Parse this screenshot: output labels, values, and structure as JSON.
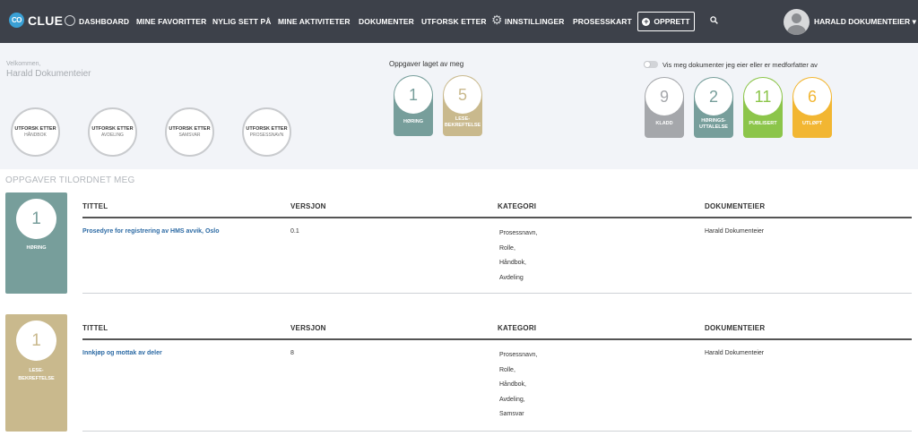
{
  "nav": {
    "logo_mark": "CO",
    "logo_text": "CLUE",
    "items": [
      "DASHBOARD",
      "MINE FAVORITTER",
      "NYLIG SETT PÅ",
      "MINE AKTIVITETER",
      "DOKUMENTER",
      "UTFORSK ETTER",
      "INNSTILLINGER",
      "PROSESSKART"
    ],
    "create_label": "OPPRETT",
    "user_name": "HARALD DOKUMENTEIER"
  },
  "welcome": {
    "small": "Velkommen,",
    "name": "Harald Dokumenteier"
  },
  "explore": [
    {
      "line1": "UTFORSK ETTER",
      "line2": "HÅNDBOK"
    },
    {
      "line1": "UTFORSK ETTER",
      "line2": "AVDELING"
    },
    {
      "line1": "UTFORSK ETTER",
      "line2": "SAMSVAR"
    },
    {
      "line1": "UTFORSK ETTER",
      "line2": "PROSESSNAVN"
    }
  ],
  "tasks_by_me": {
    "title": "Oppgaver laget av meg",
    "cards": [
      {
        "count": "1",
        "label1": "HØRING",
        "label2": "",
        "color": "#779e9b"
      },
      {
        "count": "5",
        "label1": "LESE-",
        "label2": "BEKREFTELSE",
        "color": "#c9b98d"
      }
    ]
  },
  "my_docs": {
    "toggle_label": "Vis meg dokumenter jeg eier eller er medforfatter av",
    "cards": [
      {
        "count": "9",
        "label1": "KLADD",
        "label2": "",
        "color": "#a5a7ab"
      },
      {
        "count": "2",
        "label1": "HØRINGS-",
        "label2": "UTTALELSE",
        "color": "#779e9b"
      },
      {
        "count": "11",
        "label1": "PUBLISERT",
        "label2": "",
        "color": "#8cc54a"
      },
      {
        "count": "6",
        "label1": "UTLØPT",
        "label2": "",
        "color": "#f2b632"
      }
    ]
  },
  "assigned": {
    "title": "OPPGAVER TILORDNET MEG",
    "headers": {
      "title": "TITTEL",
      "version": "VERSJON",
      "category": "KATEGORI",
      "owner": "DOKUMENTEIER"
    },
    "groups": [
      {
        "count": "1",
        "label1": "HØRING",
        "label2": "",
        "color": "#779e9b",
        "doc_title": "Prosedyre for registrering av HMS avvik, Oslo",
        "version": "0.1",
        "categories": [
          "Prosessnavn,",
          "Rolle,",
          "Håndbok,",
          "Avdeling"
        ],
        "owner": "Harald Dokumenteier"
      },
      {
        "count": "1",
        "label1": "LESE-",
        "label2": "BEKREFTELSE",
        "color": "#c9b98d",
        "doc_title": "Innkjøp og mottak av deler",
        "version": "8",
        "categories": [
          "Prosessnavn,",
          "Rolle,",
          "Håndbok,",
          "Avdeling,",
          "Samsvar"
        ],
        "owner": "Harald Dokumenteier"
      }
    ]
  }
}
